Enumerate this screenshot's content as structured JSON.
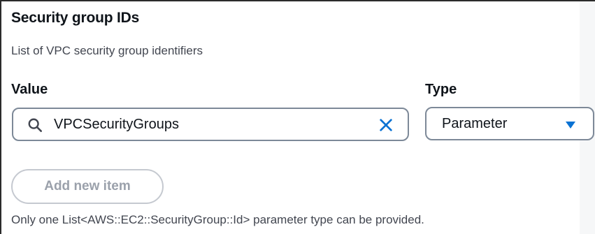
{
  "section": {
    "title": "Security group IDs",
    "description": "List of VPC security group identifiers"
  },
  "value_field": {
    "label": "Value",
    "value": "VPCSecurityGroups",
    "search_icon": "search-icon",
    "clear_icon": "close-icon"
  },
  "type_field": {
    "label": "Type",
    "selected": "Parameter",
    "caret_icon": "caret-down-icon"
  },
  "add_item": {
    "label": "Add new item",
    "disabled": true
  },
  "constraint_text": "Only one List<AWS::EC2::SecurityGroup::Id> parameter type can be provided.",
  "colors": {
    "accent": "#0972d3",
    "border": "#7d8998",
    "disabled_text": "#9ba1ab",
    "disabled_border": "#c5c9d0",
    "text_secondary": "#424650"
  }
}
